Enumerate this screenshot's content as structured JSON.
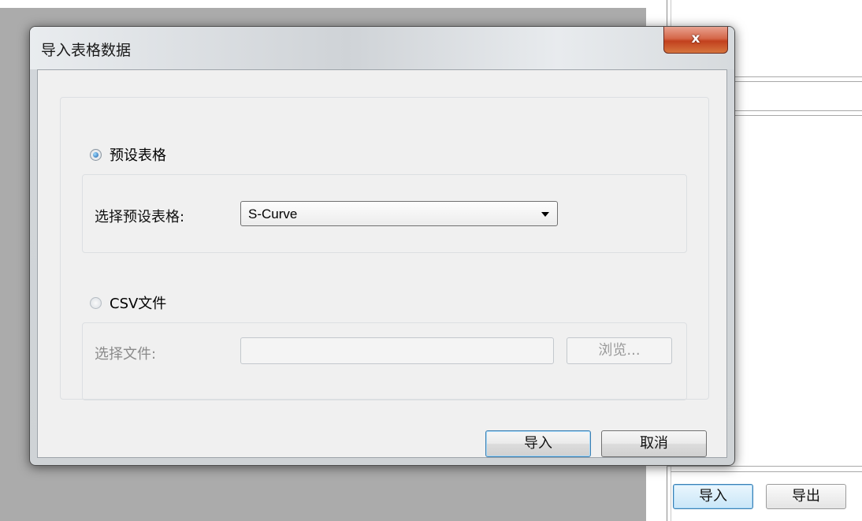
{
  "dialog": {
    "title": "导入表格数据",
    "close_label": "x",
    "preset_option": {
      "label": "预设表格",
      "selected": true,
      "select_label": "选择预设表格:",
      "select_value": "S-Curve"
    },
    "csv_option": {
      "label": "CSV文件",
      "selected": false,
      "file_label": "选择文件:",
      "file_value": "",
      "browse_label": "浏览..."
    },
    "import_label": "导入",
    "cancel_label": "取消"
  },
  "background": {
    "import_label": "导入",
    "export_label": "导出"
  }
}
